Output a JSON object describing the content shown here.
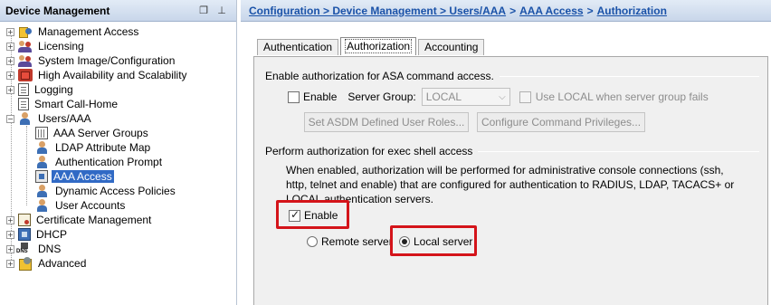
{
  "nav": {
    "title": "Device Management",
    "restore_icon": "restore-window-icon",
    "pin_icon": "pin-icon",
    "items": [
      {
        "label": "Management Access",
        "icon": "management-access-icon"
      },
      {
        "label": "Licensing",
        "icon": "licensing-icon"
      },
      {
        "label": "System Image/Configuration",
        "icon": "system-image-icon"
      },
      {
        "label": "High Availability and Scalability",
        "icon": "high-availability-icon"
      },
      {
        "label": "Logging",
        "icon": "logging-icon"
      },
      {
        "label": "Smart Call-Home",
        "icon": "smart-call-home-icon"
      },
      {
        "label": "Users/AAA",
        "icon": "users-aaa-icon"
      },
      {
        "label": "AAA Server Groups",
        "icon": "aaa-server-groups-icon"
      },
      {
        "label": "LDAP Attribute Map",
        "icon": "ldap-attribute-map-icon"
      },
      {
        "label": "Authentication Prompt",
        "icon": "authentication-prompt-icon"
      },
      {
        "label": "AAA Access",
        "icon": "aaa-access-icon"
      },
      {
        "label": "Dynamic Access Policies",
        "icon": "dynamic-access-policies-icon"
      },
      {
        "label": "User Accounts",
        "icon": "user-accounts-icon"
      },
      {
        "label": "Certificate Management",
        "icon": "certificate-management-icon"
      },
      {
        "label": "DHCP",
        "icon": "dhcp-icon"
      },
      {
        "label": "DNS",
        "icon": "dns-icon"
      },
      {
        "label": "Advanced",
        "icon": "advanced-icon"
      }
    ]
  },
  "breadcrumb": {
    "part1": "Configuration > Device Management > Users/AAA",
    "sep1": ">",
    "part2": "AAA Access",
    "sep2": ">",
    "part3": "Authorization"
  },
  "tabs": [
    {
      "label": "Authentication"
    },
    {
      "label": "Authorization"
    },
    {
      "label": "Accounting"
    }
  ],
  "command_auth": {
    "section_title": "Enable authorization for ASA command access.",
    "enable_label": "Enable",
    "enable_checked": false,
    "server_group_label": "Server Group:",
    "server_group_value": "LOCAL",
    "use_local_label": "Use LOCAL when server group fails",
    "set_roles_button": "Set ASDM Defined User Roles...",
    "configure_privileges_button": "Configure Command Privileges..."
  },
  "exec_shell": {
    "section_title": "Perform authorization for exec shell access",
    "description": "When enabled, authorization will be performed for administrative console connections (ssh, http, telnet and enable) that are configured for authentication to RADIUS, LDAP, TACACS+ or LOCAL authentication servers.",
    "enable_label": "Enable",
    "enable_checked": true,
    "remote_server_label": "Remote server",
    "local_server_label": "Local server",
    "selected": "Local server"
  },
  "colors": {
    "highlight": "#d4141a",
    "breadcrumb": "#1a52a8",
    "selection": "#316ac5"
  }
}
